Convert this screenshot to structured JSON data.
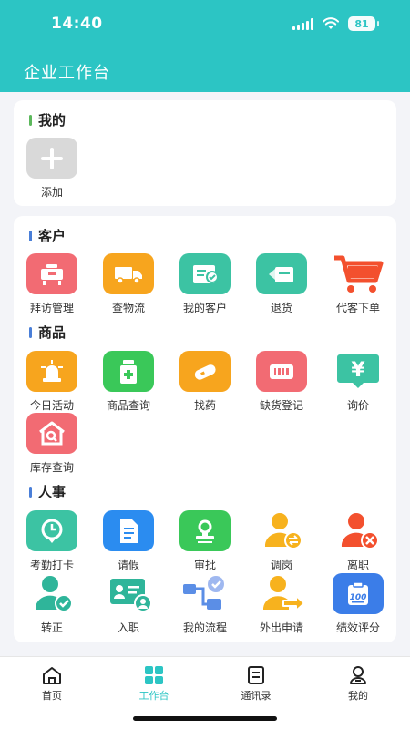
{
  "status": {
    "time": "14:40",
    "battery": "81"
  },
  "header": {
    "title": "企业工作台"
  },
  "colors": {
    "brand": "#2cc5c4",
    "mine_bar": "#5cb85c",
    "section_bar": "#4a7fd8"
  },
  "mine": {
    "title": "我的",
    "add_label": "添加"
  },
  "sections": [
    {
      "title": "客户",
      "items": [
        {
          "label": "拜访管理",
          "icon": "visit-icon"
        },
        {
          "label": "查物流",
          "icon": "truck-icon"
        },
        {
          "label": "我的客户",
          "icon": "customer-card-icon"
        },
        {
          "label": "退货",
          "icon": "return-box-icon"
        },
        {
          "label": "代客下单",
          "icon": "cart-icon"
        }
      ]
    },
    {
      "title": "商品",
      "items": [
        {
          "label": "今日活动",
          "icon": "alarm-light-icon"
        },
        {
          "label": "商品查询",
          "icon": "medicine-bottle-icon"
        },
        {
          "label": "找药",
          "icon": "pill-icon"
        },
        {
          "label": "缺货登记",
          "icon": "barcode-icon"
        },
        {
          "label": "询价",
          "icon": "yen-tag-icon"
        },
        {
          "label": "库存查询",
          "icon": "warehouse-search-icon"
        }
      ]
    },
    {
      "title": "人事",
      "items": [
        {
          "label": "考勤打卡",
          "icon": "clock-pin-icon"
        },
        {
          "label": "请假",
          "icon": "document-icon"
        },
        {
          "label": "审批",
          "icon": "stamp-icon"
        },
        {
          "label": "调岗",
          "icon": "transfer-person-icon"
        },
        {
          "label": "离职",
          "icon": "resign-person-icon"
        },
        {
          "label": "转正",
          "icon": "confirmed-person-icon"
        },
        {
          "label": "入职",
          "icon": "id-card-icon"
        },
        {
          "label": "我的流程",
          "icon": "flowchart-icon"
        },
        {
          "label": "外出申请",
          "icon": "out-person-icon"
        },
        {
          "label": "绩效评分",
          "icon": "score-clipboard-icon"
        }
      ]
    }
  ],
  "nav": [
    {
      "label": "首页",
      "icon": "home-icon"
    },
    {
      "label": "工作台",
      "icon": "grid-icon",
      "active": true
    },
    {
      "label": "通讯录",
      "icon": "contacts-icon"
    },
    {
      "label": "我的",
      "icon": "profile-icon"
    }
  ]
}
